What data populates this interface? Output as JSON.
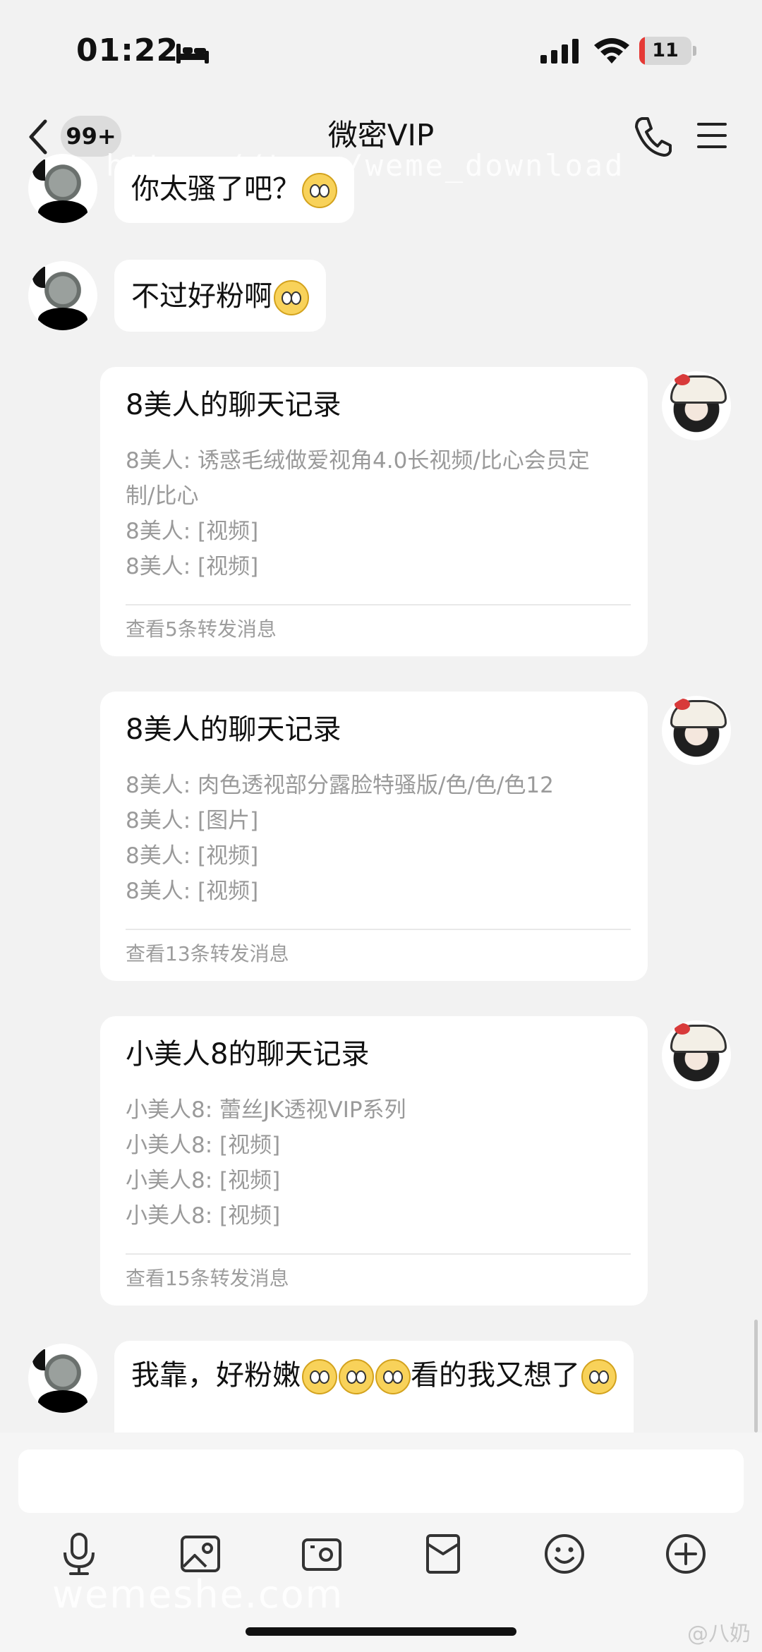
{
  "status_bar": {
    "time": "01:22",
    "battery_level": "11",
    "battery_fraction": 0.11
  },
  "header": {
    "back_badge": "99+",
    "title": "微密VIP"
  },
  "watermarks": {
    "top": "https://t.me/weme_download",
    "bottom": "wemeshe.com",
    "corner": "@八奶"
  },
  "messages": [
    {
      "side": "left",
      "avatar": "panda-avatar",
      "text": "你太骚了吧？",
      "emoji_count": 1
    },
    {
      "side": "left",
      "avatar": "panda-avatar",
      "text": "不过好粉啊",
      "emoji_count": 1
    }
  ],
  "forwarded_cards": [
    {
      "title": "8美人的聊天记录",
      "lines": [
        "8美人: 诱惑毛绒做爱视角4.0长视频/比心会员定",
        "制/比心",
        "8美人: [视频]",
        "8美人: [视频]"
      ],
      "footer": "查看5条转发消息"
    },
    {
      "title": "8美人的聊天记录",
      "lines": [
        "8美人: 肉色透视部分露脸特骚版/色/色/色12",
        "8美人: [图片]",
        "8美人: [视频]",
        "8美人: [视频]"
      ],
      "footer": "查看13条转发消息"
    },
    {
      "title": "小美人8的聊天记录",
      "lines": [
        "小美人8: 蕾丝JK透视VIP系列",
        "小美人8: [视频]",
        "小美人8: [视频]",
        "小美人8: [视频]"
      ],
      "footer": "查看15条转发消息"
    }
  ],
  "last_message": {
    "side": "left",
    "text_a": "我靠，好粉嫩",
    "text_b": "看的我又想了"
  },
  "input": {
    "placeholder": ""
  },
  "toolbar": [
    "microphone-icon",
    "image-icon",
    "camera-icon",
    "red-packet-icon",
    "emoji-icon",
    "plus-icon"
  ],
  "colors": {
    "background": "#f2f2f2",
    "bubble": "#ffffff",
    "secondary_text": "#9a9a9a",
    "battery_low": "#e53935"
  }
}
